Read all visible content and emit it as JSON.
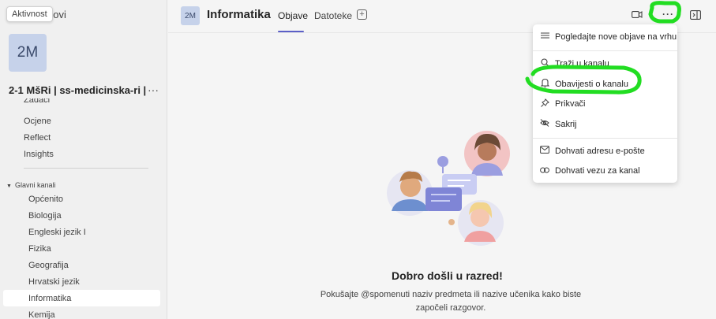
{
  "sidebar": {
    "tooltip": "Aktivnost",
    "team_name_partial": "novi",
    "team_initials": "2M",
    "class_title": "2-1 MšRi | ss-medicinska-ri |...",
    "more": "···",
    "cutoff_item": "Zadaci",
    "nav": [
      "Ocjene",
      "Reflect",
      "Insights"
    ],
    "section": "Glavni kanali",
    "channels": [
      "Općenito",
      "Biologija",
      "Engleski jezik I",
      "Fizika",
      "Geografija",
      "Hrvatski jezik",
      "Informatika",
      "Kemija"
    ]
  },
  "header": {
    "initials": "2M",
    "title": "Informatika",
    "tabs": [
      "Objave",
      "Datoteke"
    ],
    "add": "+",
    "more": "···"
  },
  "main": {
    "welcome": "Dobro došli u razred!",
    "hint": "Pokušajte @spomenuti naziv predmeta ili nazive učenika kako biste započeli razgovor."
  },
  "menu": {
    "items": [
      {
        "label": "Pogledajte nove objave na vrhu",
        "icon": "sort-icon"
      },
      {
        "label": "Traži u kanalu",
        "icon": "search-icon"
      },
      {
        "label": "Obavijesti o kanalu",
        "icon": "bell-icon"
      },
      {
        "label": "Prikvači",
        "icon": "pin-icon"
      },
      {
        "label": "Sakrij",
        "icon": "eye-off-icon"
      },
      {
        "label": "Dohvati adresu e-pošte",
        "icon": "mail-icon"
      },
      {
        "label": "Dohvati vezu za kanal",
        "icon": "link-icon"
      }
    ]
  },
  "colors": {
    "accent": "#5b5fc7",
    "annotation": "#22dd22"
  }
}
